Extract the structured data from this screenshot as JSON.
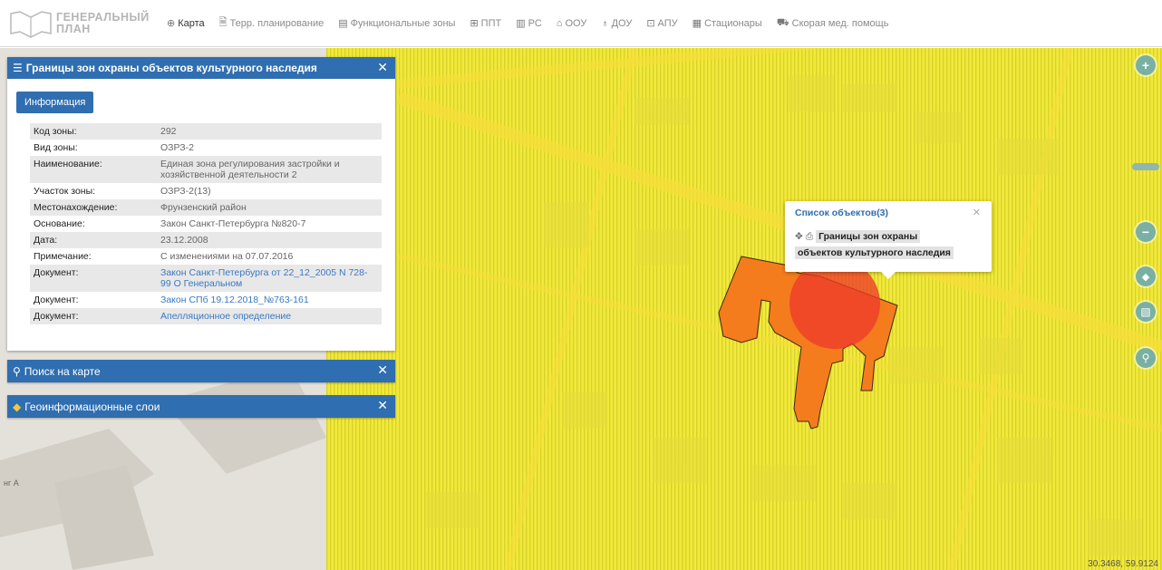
{
  "app": {
    "logo_text_line1": "ГЕНЕРАЛЬНЫЙ",
    "logo_text_line2": "ПЛАН"
  },
  "nav": {
    "items": [
      {
        "label": "Карта",
        "icon": "globe-icon"
      },
      {
        "label": "Терр. планирование",
        "icon": "document-icon"
      },
      {
        "label": "Функциональные зоны",
        "icon": "grid-list-icon"
      },
      {
        "label": "ППТ",
        "icon": "table-icon"
      },
      {
        "label": "РС",
        "icon": "book-icon"
      },
      {
        "label": "ООУ",
        "icon": "school-icon"
      },
      {
        "label": "ДОУ",
        "icon": "kindergarten-icon"
      },
      {
        "label": "АПУ",
        "icon": "clinic-icon"
      },
      {
        "label": "Стационары",
        "icon": "hospital-icon"
      },
      {
        "label": "Скорая мед. помощь",
        "icon": "ambulance-icon"
      }
    ]
  },
  "info_panel": {
    "title": "Границы зон охраны объектов культурного наследия",
    "tab_label": "Информация",
    "rows": [
      {
        "key": "Код зоны:",
        "value": "292"
      },
      {
        "key": "Вид зоны:",
        "value": "ОЗРЗ-2"
      },
      {
        "key": "Наименование:",
        "value": "Единая зона регулирования застройки и хозяйственной деятельности 2"
      },
      {
        "key": "Участок зоны:",
        "value": "ОЗРЗ-2(13)"
      },
      {
        "key": "Местонахождение:",
        "value": "Фрунзенский район"
      },
      {
        "key": "Основание:",
        "value": "Закон Санкт-Петербурга №820-7"
      },
      {
        "key": "Дата:",
        "value": "23.12.2008"
      },
      {
        "key": "Примечание:",
        "value": "С изменениями на 07.07.2016"
      },
      {
        "key": "Документ:",
        "value": "Закон Санкт-Петербурга от 22_12_2005 N 728-99 О Генеральном"
      },
      {
        "key": "Документ:",
        "value": "Закон СПб 19.12.2018_№763-161"
      },
      {
        "key": "Документ:",
        "value": "Апелляционное определение"
      }
    ]
  },
  "search_panel": {
    "title": "Поиск на карте"
  },
  "layers_panel": {
    "title": "Геоинформационные слои"
  },
  "popup": {
    "title": "Список объектов(3)",
    "item_label_line1": "Границы зон охраны",
    "item_label_line2": "объектов культурного наследия"
  },
  "map": {
    "coords": "30.3468, 59.9124",
    "map_label": "нг А",
    "colors": {
      "zone_fill": "#f2ea3a",
      "road": "#f6e44a",
      "object_fill": "#f57c1c",
      "circle_fill": "#ee3b2a",
      "panel_blue": "#2f6eb0",
      "control_green": "#79b0a3"
    }
  }
}
